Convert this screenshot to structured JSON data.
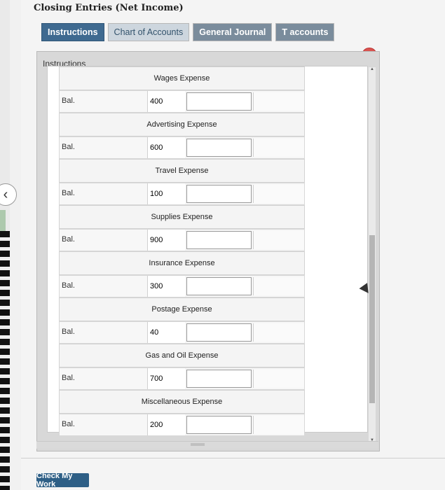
{
  "title": "Closing Entries (Net Income)",
  "tabs": [
    {
      "label": "Instructions"
    },
    {
      "label": "Chart of Accounts"
    },
    {
      "label": "General Journal"
    },
    {
      "label": "T accounts"
    }
  ],
  "panel_label": "Instructions",
  "balance_label": "Bal.",
  "accounts": [
    {
      "name": "Wages Expense",
      "balance": "400"
    },
    {
      "name": "Advertising Expense",
      "balance": "600"
    },
    {
      "name": "Travel Expense",
      "balance": "100"
    },
    {
      "name": "Supplies Expense",
      "balance": "900"
    },
    {
      "name": "Insurance Expense",
      "balance": "300"
    },
    {
      "name": "Postage Expense",
      "balance": "40"
    },
    {
      "name": "Gas and Oil Expense",
      "balance": "700"
    },
    {
      "name": "Miscellaneous Expense",
      "balance": "200"
    }
  ],
  "check_button": "Check My Work",
  "icons": {
    "close": "close-icon",
    "back": "chevron-left-icon",
    "cursor": "mouse-pointer-icon"
  },
  "colors": {
    "active_tab": "#3f6a90",
    "close": "#d9534f",
    "check_button": "#2e5f86"
  }
}
